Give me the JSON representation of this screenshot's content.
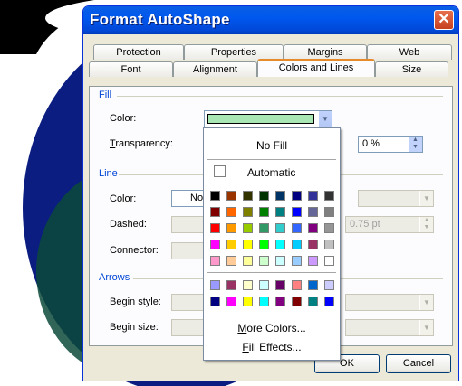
{
  "dialog": {
    "title": "Format AutoShape",
    "close_glyph": "✕",
    "tabs_back": [
      "Protection",
      "Properties",
      "Margins",
      "Web"
    ],
    "tabs_front": [
      "Font",
      "Alignment",
      "Colors and Lines",
      "Size"
    ],
    "active_tab": "Colors and Lines"
  },
  "fill": {
    "group": "Fill",
    "color_label": "Color:",
    "color_value": "#a8e6b4",
    "transparency_label": "Transparency:",
    "transparency_value": "0 %"
  },
  "line": {
    "group": "Line",
    "color_label": "Color:",
    "color_value": "No",
    "dashed_label": "Dashed:",
    "connector_label": "Connector:",
    "weight_value": "0.75 pt"
  },
  "arrows": {
    "group": "Arrows",
    "begin_style_label": "Begin style:",
    "begin_size_label": "Begin size:"
  },
  "buttons": {
    "ok": "OK",
    "cancel": "Cancel"
  },
  "popup": {
    "no_fill": "No Fill",
    "automatic": "Automatic",
    "more_colors": "More Colors...",
    "fill_effects": "Fill Effects...",
    "palette_rows": [
      [
        "#000000",
        "#993300",
        "#333300",
        "#003300",
        "#003366",
        "#000080",
        "#333399",
        "#333333"
      ],
      [
        "#800000",
        "#ff6600",
        "#808000",
        "#008000",
        "#008080",
        "#0000ff",
        "#666699",
        "#808080"
      ],
      [
        "#ff0000",
        "#ff9900",
        "#99cc00",
        "#339966",
        "#33cccc",
        "#3366ff",
        "#800080",
        "#969696"
      ],
      [
        "#ff00ff",
        "#ffcc00",
        "#ffff00",
        "#00ff00",
        "#00ffff",
        "#00ccff",
        "#993366",
        "#c0c0c0"
      ],
      [
        "#ff99cc",
        "#ffcc99",
        "#ffff99",
        "#ccffcc",
        "#ccffff",
        "#99ccff",
        "#cc99ff",
        "#ffffff"
      ]
    ],
    "extra_rows": [
      [
        "#9999ff",
        "#993366",
        "#ffffcc",
        "#ccffff",
        "#660066",
        "#ff8080",
        "#0066cc",
        "#ccccff"
      ],
      [
        "#000080",
        "#ff00ff",
        "#ffff00",
        "#00ffff",
        "#800080",
        "#800000",
        "#008080",
        "#0000ff"
      ]
    ]
  }
}
